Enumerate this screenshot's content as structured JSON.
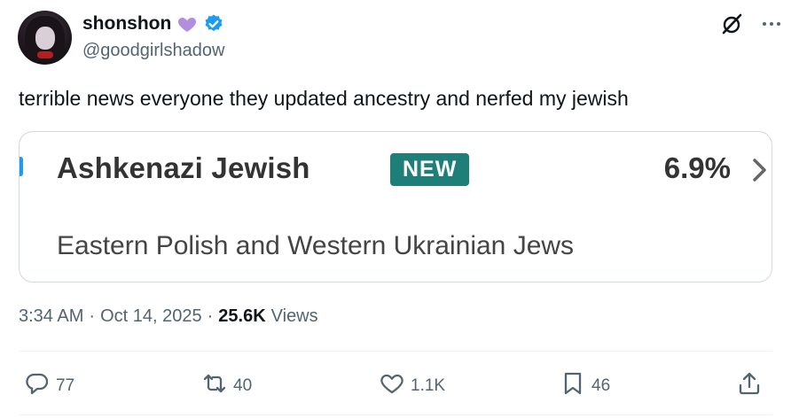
{
  "author": {
    "display_name": "shonshon",
    "handle": "@goodgirlshadow",
    "avatar_icon": "profile-photo",
    "name_emoji": "purple-heart-icon",
    "verified_icon": "verified-badge-icon",
    "verified_color": "#1d9bf0"
  },
  "tweet": {
    "text": "terrible news everyone they updated ancestry and nerfed my jewish"
  },
  "card": {
    "ethnicity": "Ashkenazi Jewish",
    "badge": "NEW",
    "badge_color": "#1e7f79",
    "percent": "6.9%",
    "region": "Eastern Polish and Western Ukrainian Jews"
  },
  "meta": {
    "time": "3:34 AM",
    "separator": "·",
    "date": "Oct 14, 2025",
    "views_count": "25.6K",
    "views_label": "Views"
  },
  "actions": {
    "replies": "77",
    "reposts": "40",
    "likes": "1.1K",
    "bookmarks": "46"
  },
  "colors": {
    "text_primary": "#0f1419",
    "text_secondary": "#536471",
    "border": "#cfd9de"
  }
}
